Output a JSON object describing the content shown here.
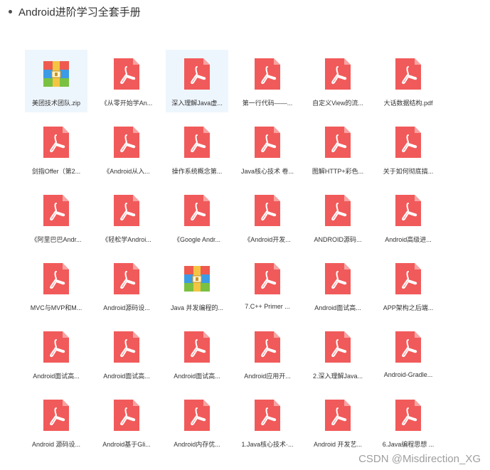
{
  "heading": "Android进阶学习全套手册",
  "watermark": "CSDN @Misdirection_XG",
  "colors": {
    "pdf": "#f15a5a",
    "pdf_fold": "#f7a3a3",
    "selected_bg": "#eef6fd"
  },
  "files": [
    {
      "name": "美团技术团队.zip",
      "icon": "archive-icon",
      "selected": true
    },
    {
      "name": "《从零开始学An...",
      "icon": "pdf-icon",
      "selected": false
    },
    {
      "name": "深入理解Java虚...",
      "icon": "pdf-icon",
      "selected": true
    },
    {
      "name": "第一行代码——...",
      "icon": "pdf-icon",
      "selected": false
    },
    {
      "name": "自定义View的流...",
      "icon": "pdf-icon",
      "selected": false
    },
    {
      "name": "大话数据结构.pdf",
      "icon": "pdf-icon",
      "selected": false
    },
    {
      "name": "剑指Offer（第2...",
      "icon": "pdf-icon",
      "selected": false
    },
    {
      "name": "《Android从入...",
      "icon": "pdf-icon",
      "selected": false
    },
    {
      "name": "操作系统概念第...",
      "icon": "pdf-icon",
      "selected": false
    },
    {
      "name": "Java核心技术 卷...",
      "icon": "pdf-icon",
      "selected": false
    },
    {
      "name": "图解HTTP+彩色...",
      "icon": "pdf-icon",
      "selected": false
    },
    {
      "name": "关于如何彻底搞...",
      "icon": "pdf-icon",
      "selected": false
    },
    {
      "name": "《阿里巴巴Andr...",
      "icon": "pdf-icon",
      "selected": false
    },
    {
      "name": "《轻松学Androi...",
      "icon": "pdf-icon",
      "selected": false
    },
    {
      "name": "《Google Andr...",
      "icon": "pdf-icon",
      "selected": false
    },
    {
      "name": "《Android开发...",
      "icon": "pdf-icon",
      "selected": false
    },
    {
      "name": "ANDROID源码...",
      "icon": "pdf-icon",
      "selected": false
    },
    {
      "name": "Android高级进...",
      "icon": "pdf-icon",
      "selected": false
    },
    {
      "name": "MVC与MVP和M...",
      "icon": "pdf-icon",
      "selected": false
    },
    {
      "name": "Android源码设...",
      "icon": "pdf-icon",
      "selected": false
    },
    {
      "name": "Java 并发编程的...",
      "icon": "archive-icon",
      "selected": false
    },
    {
      "name": "7.C++ Primer ...",
      "icon": "pdf-icon",
      "selected": false
    },
    {
      "name": "Android面试高...",
      "icon": "pdf-icon",
      "selected": false
    },
    {
      "name": "APP架构之后端...",
      "icon": "pdf-icon",
      "selected": false
    },
    {
      "name": "Android面试高...",
      "icon": "pdf-icon",
      "selected": false
    },
    {
      "name": "Android面试高...",
      "icon": "pdf-icon",
      "selected": false
    },
    {
      "name": "Android面试高...",
      "icon": "pdf-icon",
      "selected": false
    },
    {
      "name": "Android应用开...",
      "icon": "pdf-icon",
      "selected": false
    },
    {
      "name": "2.深入理解Java...",
      "icon": "pdf-icon",
      "selected": false
    },
    {
      "name": "Android-Gradle...",
      "icon": "pdf-icon",
      "selected": false
    },
    {
      "name": "Android 源码设...",
      "icon": "pdf-icon",
      "selected": false
    },
    {
      "name": "Android基于Gli...",
      "icon": "pdf-icon",
      "selected": false
    },
    {
      "name": "Android内存优...",
      "icon": "pdf-icon",
      "selected": false
    },
    {
      "name": "1.Java核心技术·...",
      "icon": "pdf-icon",
      "selected": false
    },
    {
      "name": "Android 开发艺...",
      "icon": "pdf-icon",
      "selected": false
    },
    {
      "name": "6.Java编程思想 ...",
      "icon": "pdf-icon",
      "selected": false
    }
  ]
}
